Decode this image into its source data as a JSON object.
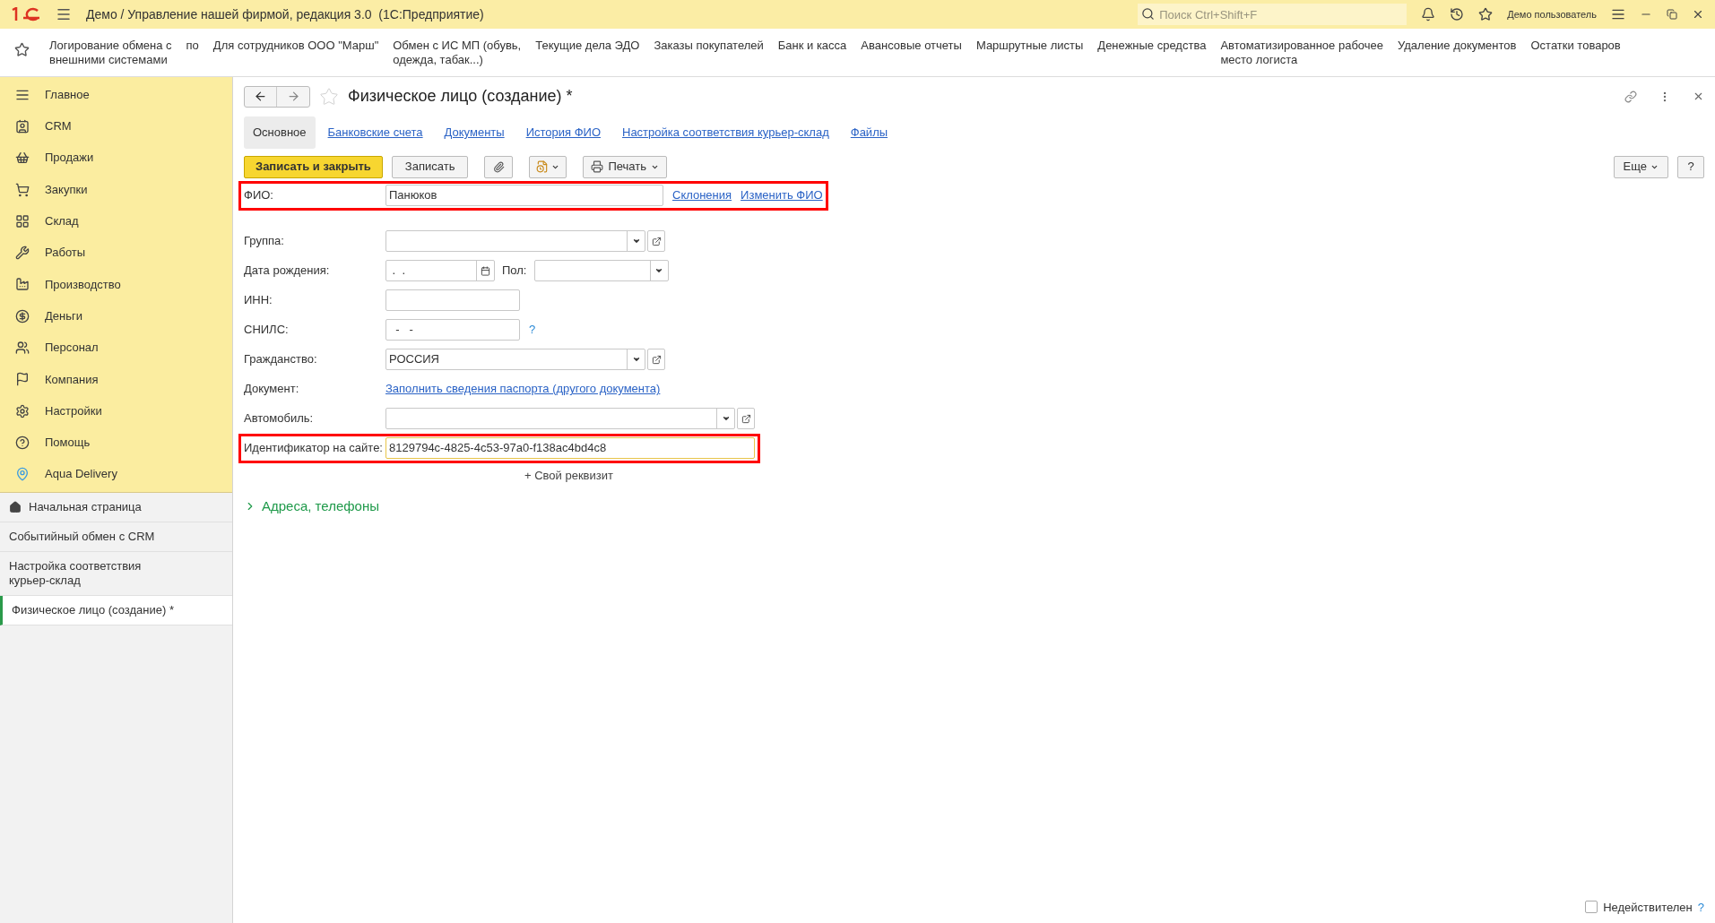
{
  "title_bar": {
    "title": "Демо / Управление нашей фирмой, редакция 3.0  (1С:Предприятие)",
    "search": {
      "placeholder": "Поиск Ctrl+Shift+F"
    },
    "user": "Демо пользователь"
  },
  "favorites": [
    {
      "label": "Логирование обмена с\nвнешними системами"
    },
    {
      "label": "по"
    },
    {
      "label": "Для сотрудников ООО \"Марш\""
    },
    {
      "label": "Обмен с ИС МП (обувь,\nодежда, табак...)"
    },
    {
      "label": "Текущие дела ЭДО"
    },
    {
      "label": "Заказы покупателей"
    },
    {
      "label": "Банк и касса"
    },
    {
      "label": "Авансовые отчеты"
    },
    {
      "label": "Маршрутные листы"
    },
    {
      "label": "Денежные средства"
    },
    {
      "label": "Автоматизированное рабочее\nместо логиста"
    },
    {
      "label": "Удаление документов"
    },
    {
      "label": "Остатки товаров"
    }
  ],
  "sections": [
    {
      "label": "Главное"
    },
    {
      "label": "CRM"
    },
    {
      "label": "Продажи"
    },
    {
      "label": "Закупки"
    },
    {
      "label": "Склад"
    },
    {
      "label": "Работы"
    },
    {
      "label": "Производство"
    },
    {
      "label": "Деньги"
    },
    {
      "label": "Персонал"
    },
    {
      "label": "Компания"
    },
    {
      "label": "Настройки"
    },
    {
      "label": "Помощь"
    },
    {
      "label": "Aqua Delivery"
    }
  ],
  "open_windows": [
    {
      "label": "Начальная страница",
      "kind": "home",
      "selected": false
    },
    {
      "label": "Событийный обмен с CRM",
      "kind": "window",
      "selected": false
    },
    {
      "label": "Настройка соответствия\nкурьер-склад",
      "kind": "window",
      "selected": false
    },
    {
      "label": "Физическое лицо (создание) *",
      "kind": "window",
      "selected": true
    }
  ],
  "form": {
    "title": "Физическое лицо (создание) *",
    "tabs": [
      {
        "label": "Основное",
        "selected": true
      },
      {
        "label": "Банковские счета",
        "selected": false
      },
      {
        "label": "Документы",
        "selected": false
      },
      {
        "label": "История ФИО",
        "selected": false
      },
      {
        "label": "Настройка соответствия курьер-склад",
        "selected": false
      },
      {
        "label": "Файлы",
        "selected": false
      }
    ],
    "buttons": {
      "save_close": "Записать и закрыть",
      "save": "Записать",
      "print": "Печать",
      "more": "Еще",
      "help": "?"
    },
    "fields": [
      {
        "kind": "fio",
        "label": "ФИО:",
        "value": "Панюков",
        "highlighted": true,
        "links": [
          "Склонения",
          "Изменить ФИО"
        ]
      },
      {
        "kind": "combo",
        "label": "Группа:",
        "highlighted": false
      },
      {
        "kind": "date",
        "label": "Дата рождения:",
        "value": " .  .",
        "second_label": "Пол:",
        "highlighted": false
      },
      {
        "kind": "short",
        "label": "ИНН:",
        "highlighted": false
      },
      {
        "kind": "short",
        "label": "СНИЛС:",
        "value": "  -   -",
        "hint": "?",
        "highlighted": false
      },
      {
        "kind": "combo",
        "label": "Гражданство:",
        "value": "РОССИЯ",
        "highlighted": false
      },
      {
        "kind": "link",
        "label": "Документ:",
        "value": "Заполнить сведения паспорта (другого документа)",
        "highlighted": false
      },
      {
        "kind": "wide_combo",
        "label": "Автомобиль:",
        "highlighted": false
      },
      {
        "kind": "wide",
        "label": "Идентификатор на сайте:",
        "value": "8129794c-4825-4c53-97a0-f138ac4bd4c8",
        "highlighted": true,
        "focused": true
      }
    ],
    "add_attribute": "+ Свой реквизит",
    "group": {
      "label": "Адреса, телефоны",
      "expanded": false
    },
    "inactive": {
      "label": "Недействителен",
      "checked": false,
      "hint": "?"
    }
  }
}
